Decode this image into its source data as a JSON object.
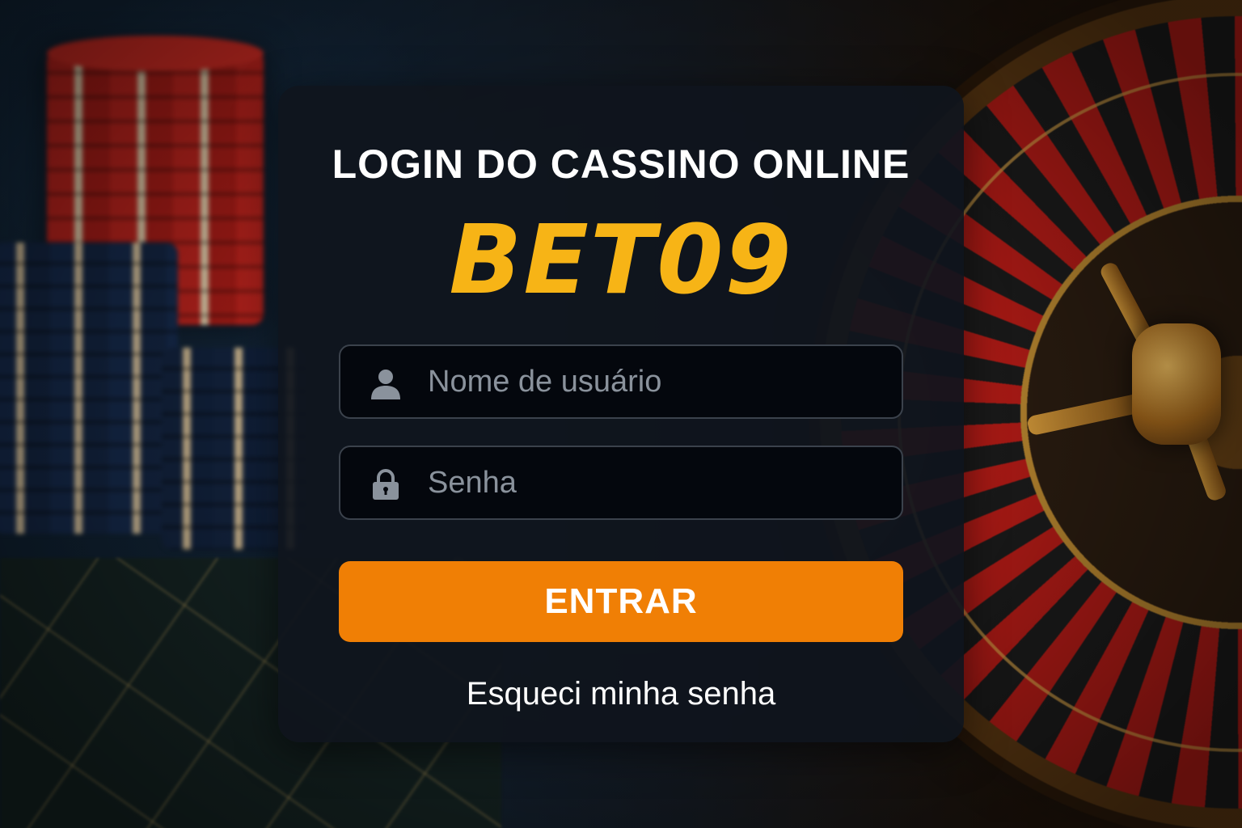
{
  "login": {
    "title": "LOGIN DO CASSINO ONLINE",
    "brand": "BET09",
    "username_placeholder": "Nome de usuário",
    "password_placeholder": "Senha",
    "submit_label": "ENTRAR",
    "forgot_password_label": "Esqueci minha senha"
  },
  "icons": {
    "username": "user-icon",
    "password": "lock-icon"
  },
  "colors": {
    "brand": "#f7b416",
    "button": "#f07f05",
    "card_background": "#0f141d",
    "input_background": "#04070d",
    "text": "#ffffff",
    "placeholder": "#8a929c"
  }
}
